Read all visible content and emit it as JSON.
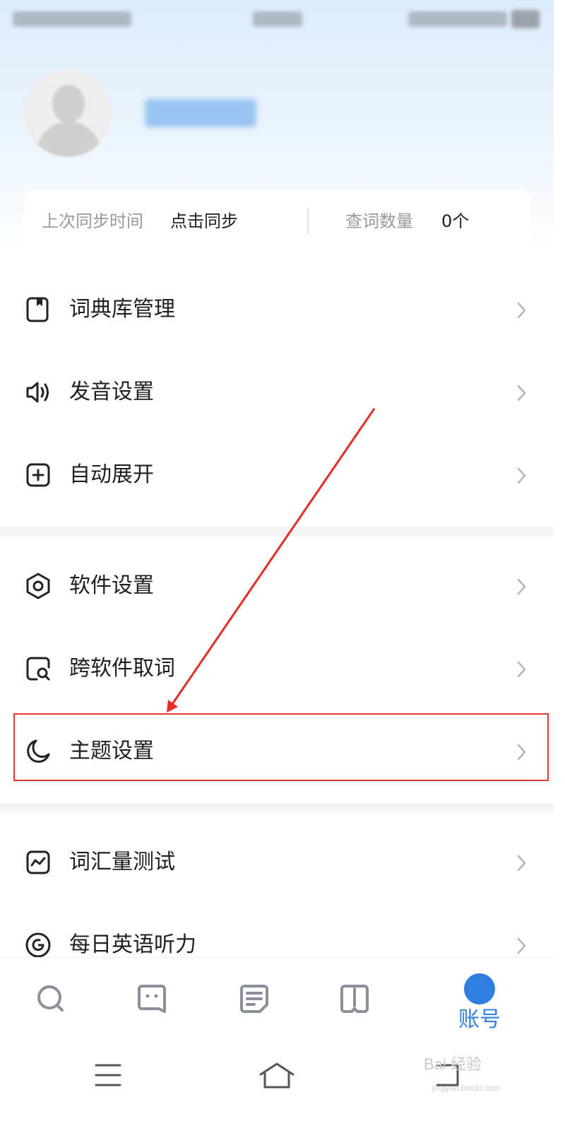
{
  "sync": {
    "last_sync_label": "上次同步时间",
    "last_sync_value": "点击同步",
    "lookup_count_label": "查词数量",
    "lookup_count_value": "0个"
  },
  "menu": {
    "group1": [
      {
        "label": "词典库管理",
        "icon": "dictionary-icon"
      },
      {
        "label": "发音设置",
        "icon": "speaker-icon"
      },
      {
        "label": "自动展开",
        "icon": "plus-square-icon"
      }
    ],
    "group2": [
      {
        "label": "软件设置",
        "icon": "hexagon-settings-icon"
      },
      {
        "label": "跨软件取词",
        "icon": "search-doc-icon"
      },
      {
        "label": "主题设置",
        "icon": "moon-icon"
      }
    ],
    "group3": [
      {
        "label": "词汇量测试",
        "icon": "chart-icon"
      },
      {
        "label": "每日英语听力",
        "icon": "headphone-circle-icon"
      }
    ]
  },
  "bottom_nav": {
    "tabs": [
      {
        "icon": "search-icon"
      },
      {
        "icon": "chat-icon"
      },
      {
        "icon": "notes-icon"
      },
      {
        "icon": "book-icon"
      },
      {
        "icon": "account-icon",
        "label": "账号",
        "active": true
      }
    ]
  },
  "watermark": {
    "text": "Bai 经验",
    "sub": "jingyan.baidu.com"
  },
  "colors": {
    "accent": "#2f7fe0",
    "highlight": "#e53935",
    "separator": "#f4f5f7"
  }
}
